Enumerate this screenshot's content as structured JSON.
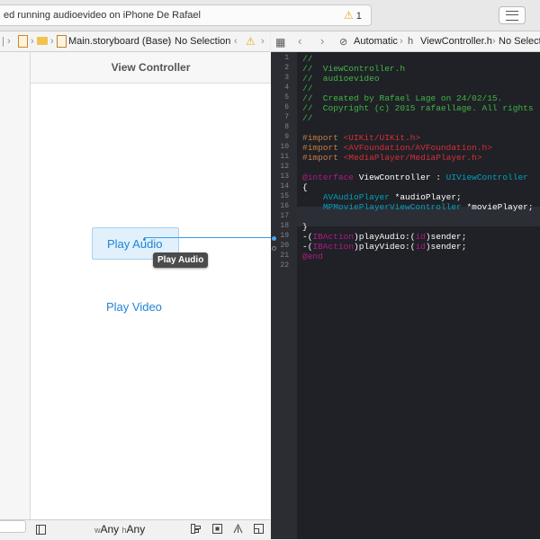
{
  "toolbar": {
    "status_text": "ed running audioevideo on iPhone De Rafael",
    "warning_count": "1"
  },
  "left_jumpbar": {
    "file": "Main.storyboard (Base)",
    "selection": "No Selection"
  },
  "right_jumpbar": {
    "mode": "Automatic",
    "file": "ViewController.h",
    "selection": "No Selectio"
  },
  "storyboard": {
    "scene_title": "View Controller",
    "play_audio_label": "Play Audio",
    "play_video_label": "Play Video",
    "tooltip": "Play Audio",
    "size_class_w_prefix": "w",
    "size_class_w": "Any",
    "size_class_h_prefix": "h",
    "size_class_h": "Any"
  },
  "code": {
    "lines": [
      {
        "n": "1",
        "text": "//"
      },
      {
        "n": "2",
        "text": "//  ViewController.h"
      },
      {
        "n": "3",
        "text": "//  audioevideo"
      },
      {
        "n": "4",
        "text": "//"
      },
      {
        "n": "5",
        "text": "//  Created by Rafael Lage on 24/02/15."
      },
      {
        "n": "6",
        "text": "//  Copyright (c) 2015 rafaellage. All rights"
      },
      {
        "n": "7",
        "text": "//"
      },
      {
        "n": "8",
        "text": ""
      },
      {
        "n": "9",
        "text": "#import <UIKit/UIKit.h>"
      },
      {
        "n": "10",
        "text": "#import <AVFoundation/AVFoundation.h>"
      },
      {
        "n": "11",
        "text": "#import <MediaPlayer/MediaPlayer.h>"
      },
      {
        "n": "12",
        "text": ""
      },
      {
        "n": "13",
        "text": "@interface ViewController : UIViewController"
      },
      {
        "n": "14",
        "text": "{"
      },
      {
        "n": "15",
        "text": "    AVAudioPlayer *audioPlayer;"
      },
      {
        "n": "16",
        "text": "    MPMoviePlayerViewController *moviePlayer;"
      },
      {
        "n": "17",
        "text": ""
      },
      {
        "n": "18",
        "text": "}"
      },
      {
        "n": "19",
        "text": "-(IBAction)playAudio:(id)sender;"
      },
      {
        "n": "20",
        "text": "-(IBAction)playVideo:(id)sender;"
      },
      {
        "n": "21",
        "text": "@end"
      },
      {
        "n": "22",
        "text": ""
      }
    ]
  },
  "colors": {
    "editor_bg": "#1f2126",
    "comment": "#41b645",
    "preprocessor": "#c77c48",
    "string": "#db2c38",
    "keyword": "#b21889",
    "type": "#00a0be",
    "link_blue": "#1f83d6",
    "warning": "#e6a817"
  },
  "icons": [
    "warning-icon",
    "lines-icon",
    "columns-icon",
    "grid-icon",
    "back-icon",
    "forward-icon",
    "folder-icon",
    "file-icon",
    "related-icon",
    "header-icon",
    "doc-outline-icon",
    "align-icon",
    "pin-icon",
    "resolve-icon",
    "resize-icon"
  ]
}
